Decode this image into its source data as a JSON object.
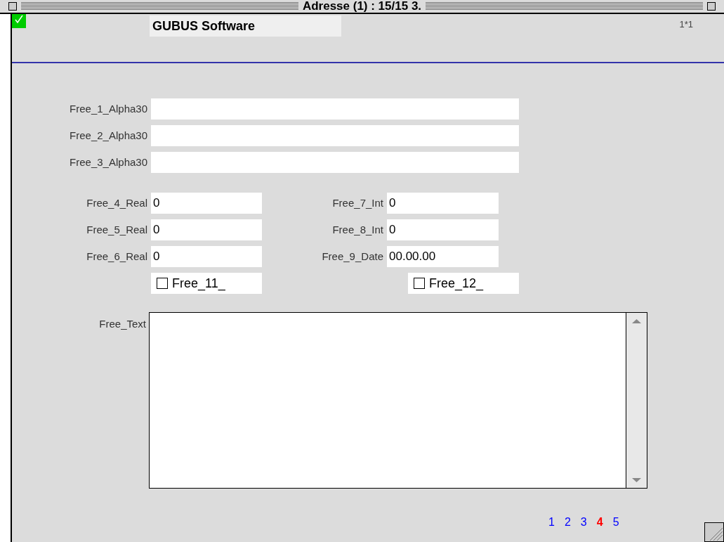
{
  "window": {
    "title": "Adresse (1) : 15/15 3."
  },
  "header": {
    "title": "GUBUS Software",
    "counter": "1*1",
    "saved": true
  },
  "text_fields": [
    {
      "label": "Free_1_Alpha30"
    },
    {
      "label": "Free_2_Alpha30"
    },
    {
      "label": "Free_3_Alpha30"
    }
  ],
  "left_fields": [
    {
      "label": "Free_4_Real",
      "value": "0"
    },
    {
      "label": "Free_5_Real",
      "value": "0"
    },
    {
      "label": "Free_6_Real",
      "value": "0"
    }
  ],
  "right_fields": [
    {
      "label": "Free_7_Int",
      "value": "0"
    },
    {
      "label": "Free_8_Int",
      "value": "0"
    },
    {
      "label": "Free_9_Date",
      "value": "00.00.00"
    }
  ],
  "checkboxes": [
    {
      "label": "Free_11_",
      "checked": false
    },
    {
      "label": "Free_12_",
      "checked": false
    }
  ],
  "memo": {
    "label": "Free_Text"
  },
  "pages": [
    {
      "label": "1",
      "selected": false
    },
    {
      "label": "2",
      "selected": false
    },
    {
      "label": "3",
      "selected": false
    },
    {
      "label": "4",
      "selected": true
    },
    {
      "label": "5",
      "selected": false
    }
  ]
}
